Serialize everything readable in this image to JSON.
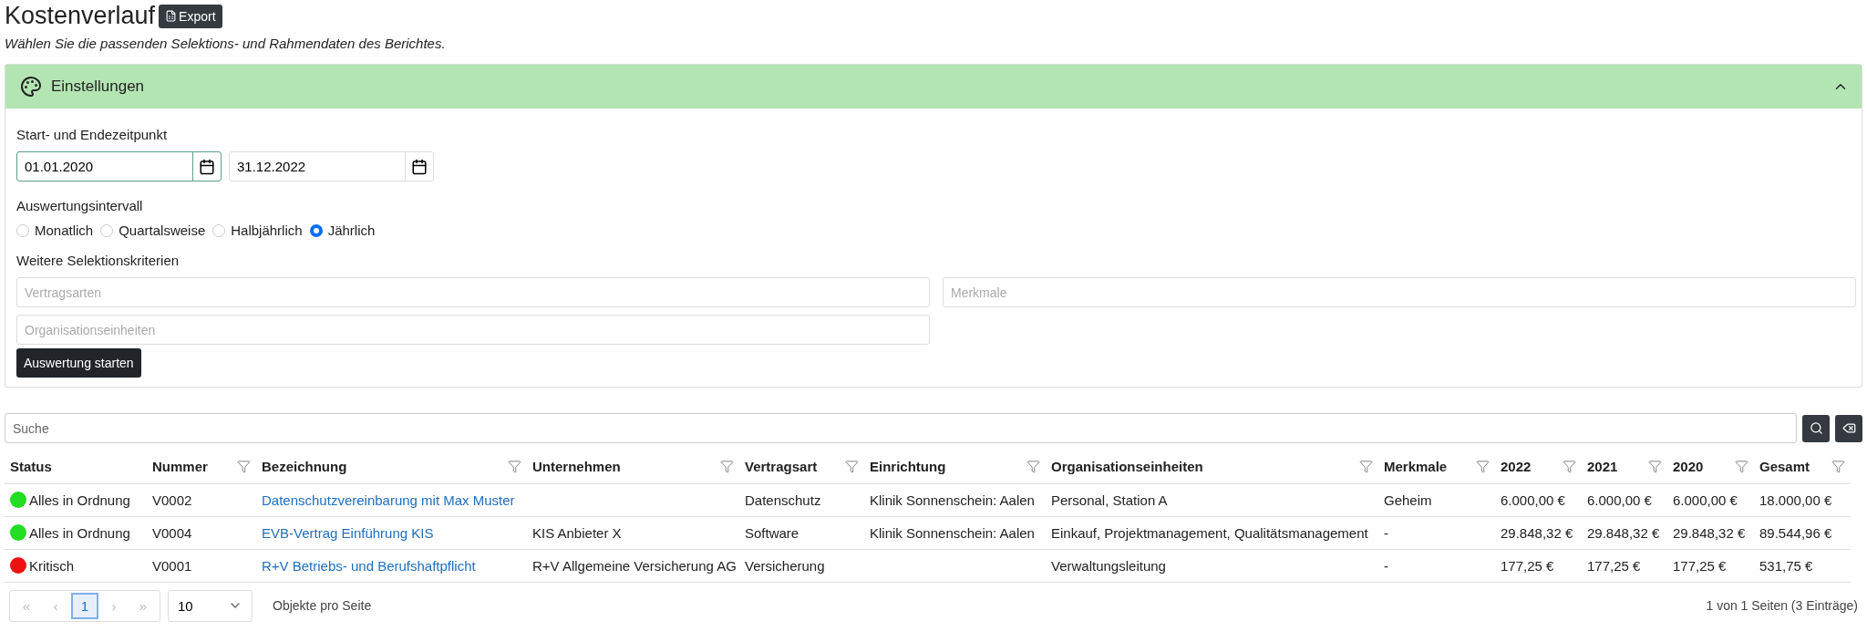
{
  "page": {
    "title": "Kostenverlauf",
    "export_label": "Export",
    "subtitle": "Wählen Sie die passenden Selektions- und Rahmendaten des Berichtes."
  },
  "settings": {
    "title": "Einstellungen",
    "expanded": true,
    "period_label": "Start- und Endezeitpunkt",
    "dates": [
      {
        "value": "01.01.2020",
        "focused": true
      },
      {
        "value": "31.12.2022",
        "focused": false
      }
    ],
    "interval_label": "Auswertungsintervall",
    "intervals": [
      {
        "label": "Monatlich",
        "selected": false
      },
      {
        "label": "Quartalsweise",
        "selected": false
      },
      {
        "label": "Halbjährlich",
        "selected": false
      },
      {
        "label": "Jährlich",
        "selected": true
      }
    ],
    "criteria_label": "Weitere Selektionskriterien",
    "criteria_fields": [
      {
        "placeholder": "Vertragsarten"
      },
      {
        "placeholder": "Merkmale"
      },
      {
        "placeholder": "Organisationseinheiten"
      }
    ],
    "start_button": "Auswertung starten"
  },
  "search": {
    "placeholder": "Suche"
  },
  "table": {
    "columns": [
      {
        "label": "Status",
        "kind": "status",
        "filterable": false
      },
      {
        "label": "Nummer",
        "kind": "text",
        "filterable": true
      },
      {
        "label": "Bezeichnung",
        "kind": "link",
        "filterable": true
      },
      {
        "label": "Unternehmen",
        "kind": "text",
        "filterable": true
      },
      {
        "label": "Vertragsart",
        "kind": "text",
        "filterable": true
      },
      {
        "label": "Einrichtung",
        "kind": "text",
        "filterable": true
      },
      {
        "label": "Organisationseinheiten",
        "kind": "text",
        "filterable": true
      },
      {
        "label": "Merkmale",
        "kind": "text",
        "filterable": true
      },
      {
        "label": "2022",
        "kind": "text",
        "filterable": true
      },
      {
        "label": "2021",
        "kind": "text",
        "filterable": true
      },
      {
        "label": "2020",
        "kind": "text",
        "filterable": true
      },
      {
        "label": "Gesamt",
        "kind": "text",
        "filterable": true
      }
    ],
    "rows": [
      {
        "color": "#22dd22",
        "cells": [
          "Alles in Ordnung",
          "V0002",
          "Datenschutzvereinbarung mit Max Muster",
          null,
          "Datenschutz",
          "Klinik Sonnenschein: Aalen",
          "Personal, Station A",
          "Geheim",
          "6.000,00 €",
          "6.000,00 €",
          "6.000,00 €",
          "18.000,00 €"
        ]
      },
      {
        "color": "#22dd22",
        "cells": [
          "Alles in Ordnung",
          "V0004",
          "EVB-Vertrag Einführung KIS",
          "KIS Anbieter X",
          "Software",
          "Klinik Sonnenschein: Aalen",
          "Einkauf, Projektmanagement, Qualitätsmanagement",
          "-",
          "29.848,32 €",
          "29.848,32 €",
          "29.848,32 €",
          "89.544,96 €"
        ]
      },
      {
        "color": "#ee1111",
        "cells": [
          "Kritisch",
          "V0001",
          "R+V Betriebs- und Berufshaftpflicht",
          "R+V Allgemeine Versicherung AG",
          "Versicherung",
          null,
          "Verwaltungsleitung",
          "-",
          "177,25 €",
          "177,25 €",
          "177,25 €",
          "531,75 €"
        ]
      }
    ]
  },
  "pagination": {
    "buttons": [
      {
        "label": "«",
        "disabled": true,
        "selected": false
      },
      {
        "label": "‹",
        "disabled": true,
        "selected": false
      },
      {
        "label": "1",
        "disabled": false,
        "selected": true
      },
      {
        "label": "›",
        "disabled": true,
        "selected": false
      },
      {
        "label": "»",
        "disabled": true,
        "selected": false
      }
    ],
    "page_size": "10",
    "page_size_label": "Objekte pro Seite",
    "summary": "1 von 1 Seiten (3 Einträge)"
  }
}
